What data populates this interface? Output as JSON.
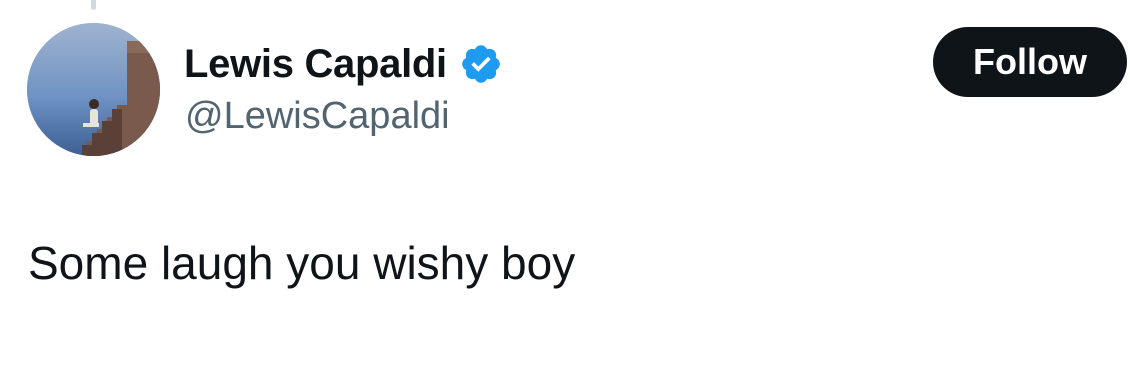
{
  "author": {
    "display_name": "Lewis Capaldi",
    "handle": "@LewisCapaldi",
    "verified": true,
    "verified_icon": "verified-badge-icon",
    "avatar": "avatar-image"
  },
  "actions": {
    "follow_label": "Follow"
  },
  "tweet": {
    "text": "Some laugh you wishy boy"
  },
  "colors": {
    "text_primary": "#0f1419",
    "text_secondary": "#536471",
    "verified_blue": "#1d9bf0",
    "button_bg": "#0f1419",
    "button_text": "#ffffff"
  }
}
